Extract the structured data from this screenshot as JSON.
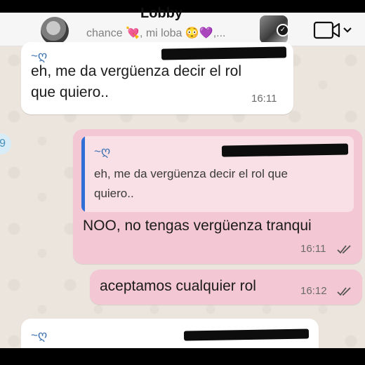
{
  "header": {
    "title": "Lobby",
    "subtitle": "chance 💘, mi loba 😳💜,...",
    "icons": {
      "video": "video-call-icon",
      "menu": "chevron-down-icon",
      "verified": "check-badge-icon"
    }
  },
  "messages": [
    {
      "direction": "incoming",
      "sender": "~ღ",
      "text_line1": "eh, me da vergüenza decir el rol",
      "text_line2": "que quiero..",
      "time": "16:11"
    },
    {
      "direction": "outgoing",
      "quote": {
        "sender": "~ღ",
        "line1": "eh, me da vergüenza decir el rol que",
        "line2": "quiero.."
      },
      "text": "NOO, no tengas vergüenza tranqui",
      "time": "16:11",
      "status": "read"
    },
    {
      "direction": "outgoing",
      "text": "aceptamos cualquier rol",
      "time": "16:12",
      "status": "read"
    },
    {
      "direction": "incoming",
      "sender": "~ღ"
    }
  ],
  "colors": {
    "chat_background": "#ece5dd",
    "incoming_bubble": "#ffffff",
    "outgoing_bubble": "#f4c7d4",
    "quote_accent": "#2f6fd6",
    "sender_name": "#3b6fb0"
  }
}
